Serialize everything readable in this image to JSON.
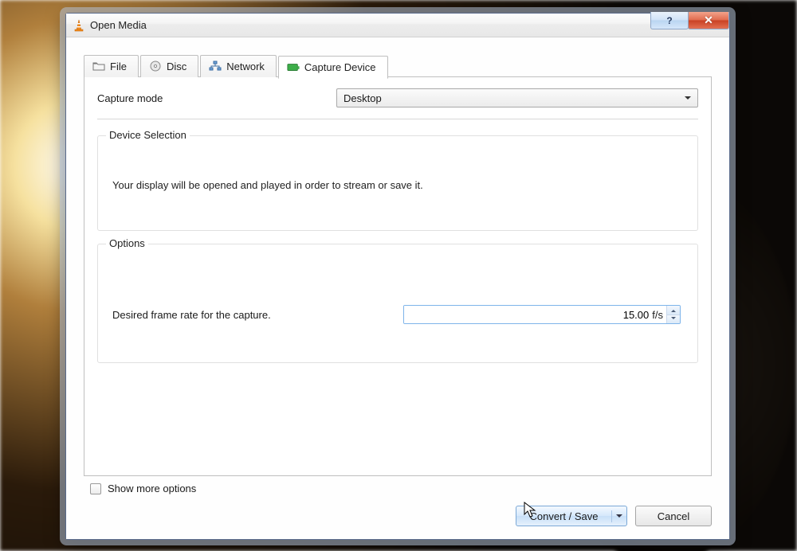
{
  "window": {
    "title": "Open Media"
  },
  "tabs": {
    "file": "File",
    "disc": "Disc",
    "network": "Network",
    "capture": "Capture Device"
  },
  "capture": {
    "mode_label": "Capture mode",
    "mode_value": "Desktop",
    "device_selection": {
      "legend": "Device Selection",
      "message": "Your display will be opened and played in order to stream or save it."
    },
    "options": {
      "legend": "Options",
      "framerate_label": "Desired frame rate for the capture.",
      "framerate_value": "15.00",
      "framerate_unit": "f/s"
    }
  },
  "footer": {
    "show_more": "Show more options",
    "convert_save": "Convert / Save",
    "cancel": "Cancel"
  }
}
